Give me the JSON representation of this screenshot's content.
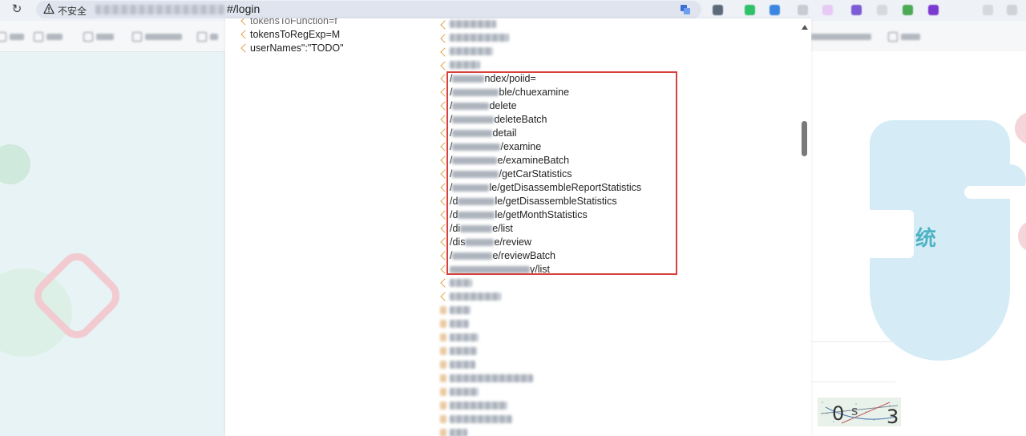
{
  "browser": {
    "security_label": "不安全",
    "url_path": "#/login",
    "colors": {
      "warning": "#333333",
      "extension_icons": [
        "#5b6a7a",
        "#2fc06a",
        "#3a86e0",
        "#c8ccd2",
        "#e6c9f5",
        "#7b5bd6",
        "#d7d9dd",
        "#4caa55",
        "#7a3ad0",
        "#d6d8dc",
        "#d0d2d6"
      ]
    }
  },
  "background_page": {
    "system_char": "统",
    "accent_color": "#4fb3c4"
  },
  "viewer": {
    "left_items": [
      "tokensToFunction=f",
      "tokensToRegExp=M",
      "userNames\":\"TODO\""
    ],
    "highlighted_paths": [
      {
        "prefix": "/",
        "suffix": "ndex/poiid="
      },
      {
        "prefix": "/",
        "suffix": "ble/chuexamine"
      },
      {
        "prefix": "/",
        "suffix": "delete"
      },
      {
        "prefix": "/",
        "suffix": "deleteBatch"
      },
      {
        "prefix": "/",
        "suffix": "detail"
      },
      {
        "prefix": "/",
        "suffix": "/examine"
      },
      {
        "prefix": "/",
        "suffix": "e/examineBatch"
      },
      {
        "prefix": "/",
        "suffix": "/getCarStatistics"
      },
      {
        "prefix": "/",
        "suffix": "le/getDisassembleReportStatistics"
      },
      {
        "prefix": "/d",
        "suffix": "le/getDisassembleStatistics"
      },
      {
        "prefix": "/d",
        "suffix": "le/getMonthStatistics"
      },
      {
        "prefix": "/di",
        "suffix": "e/list"
      },
      {
        "prefix": "/dis",
        "suffix": "e/review"
      },
      {
        "prefix": "/",
        "suffix": "e/reviewBatch"
      },
      {
        "prefix": "",
        "suffix": "y/list"
      }
    ],
    "highlight_color": "#d9403c",
    "chevron_color": "#e2a24a"
  }
}
